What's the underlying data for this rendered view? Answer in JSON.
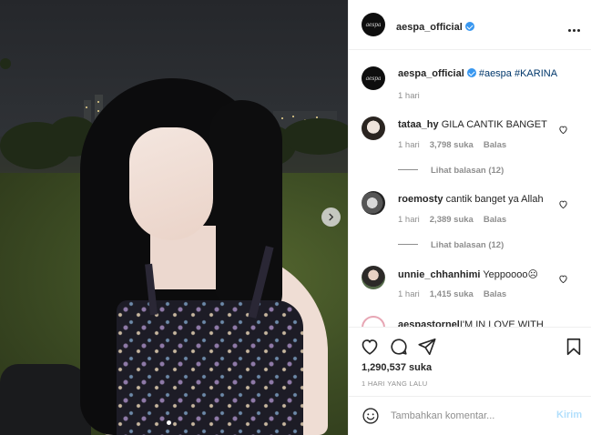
{
  "post": {
    "author": "aespa_official",
    "verified": true,
    "likes": "1,290,537 suka",
    "time": "1 HARI YANG LALU"
  },
  "caption": {
    "username": "aespa_official",
    "hashtags": "#aespa #KARINA",
    "time": "1 hari"
  },
  "comments": [
    {
      "username": "tataa_hy",
      "text": "GILA CANTIK BANGET",
      "time": "1 hari",
      "likes": "3,798 suka",
      "reply": "Balas",
      "view_replies": "Lihat balasan (12)"
    },
    {
      "username": "roemosty",
      "text": "cantik banget ya Allah",
      "time": "1 hari",
      "likes": "2,389 suka",
      "reply": "Balas",
      "view_replies": "Lihat balasan (12)"
    },
    {
      "username": "unnie_chhanhimi",
      "text": "Yeppoooo☹",
      "time": "1 hari",
      "likes": "1,415 suka",
      "reply": "Balas"
    },
    {
      "username": "aespastornel",
      "text": "I'M IN LOVE WITH"
    }
  ],
  "composer": {
    "placeholder": "Tambahkan komentar...",
    "post_label": "Kirim"
  },
  "icons": {
    "more": "more-horizontal-icon",
    "like": "heart-icon",
    "comment": "comment-bubble-icon",
    "share": "paper-plane-icon",
    "save": "bookmark-icon",
    "emoji": "smiley-icon",
    "next": "chevron-right-icon"
  },
  "colors": {
    "verified": "#3897f0",
    "post_disabled": "#b2dffc",
    "muted": "#8e8e8e"
  }
}
